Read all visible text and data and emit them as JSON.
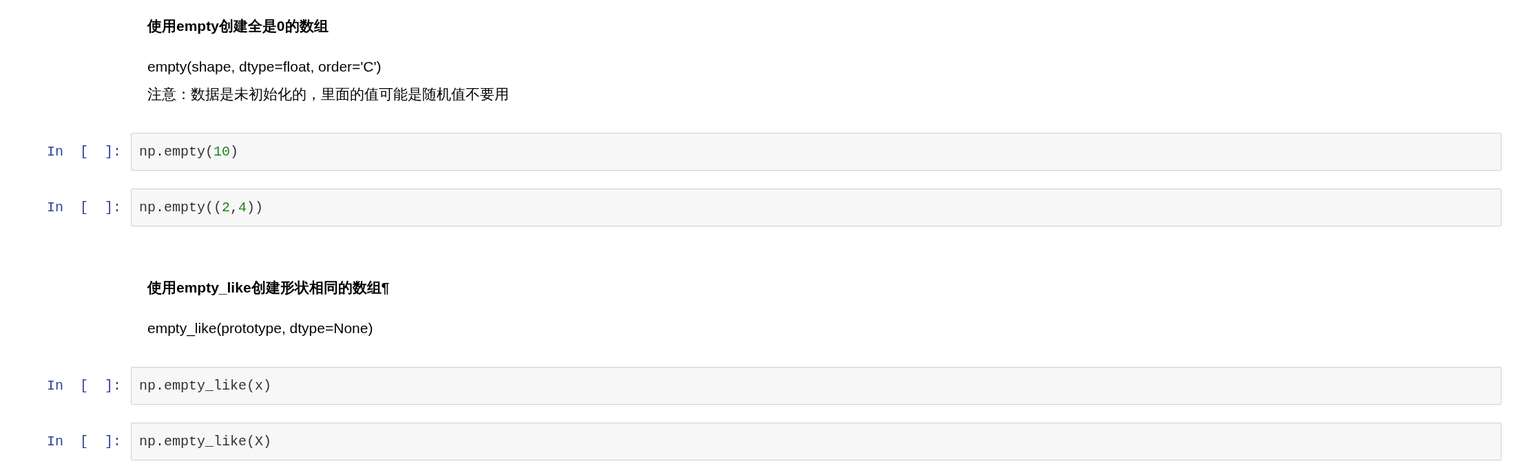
{
  "cells": [
    {
      "kind": "markdown",
      "heading": "使用empty创建全是0的数组",
      "lines": [
        "empty(shape, dtype=float, order='C')",
        "注意：数据是未初始化的，里面的值可能是随机值不要用"
      ]
    },
    {
      "kind": "code",
      "prompt": "In  [  ]:",
      "tokens": [
        {
          "kind": "plain",
          "text": "np.empty("
        },
        {
          "kind": "number",
          "text": "10"
        },
        {
          "kind": "plain",
          "text": ")"
        }
      ]
    },
    {
      "kind": "code",
      "prompt": "In  [  ]:",
      "tokens": [
        {
          "kind": "plain",
          "text": "np.empty(("
        },
        {
          "kind": "number",
          "text": "2"
        },
        {
          "kind": "plain",
          "text": ","
        },
        {
          "kind": "number",
          "text": "4"
        },
        {
          "kind": "plain",
          "text": "))"
        }
      ]
    },
    {
      "kind": "markdown",
      "heading": "使用empty_like创建形状相同的数组¶",
      "lines": [
        "empty_like(prototype, dtype=None)"
      ]
    },
    {
      "kind": "code",
      "prompt": "In  [  ]:",
      "tokens": [
        {
          "kind": "plain",
          "text": "np.empty_like(x)"
        }
      ]
    },
    {
      "kind": "code",
      "prompt": "In  [  ]:",
      "tokens": [
        {
          "kind": "plain",
          "text": "np.empty_like(X)"
        }
      ]
    }
  ]
}
